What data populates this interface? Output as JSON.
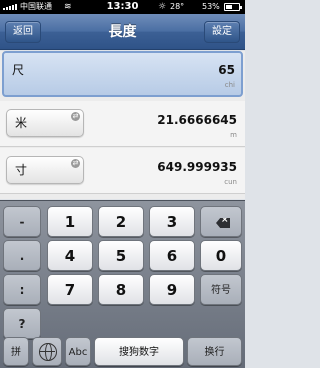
{
  "status_bar": {
    "carrier": "中国联通",
    "wifi_icon": "wifi-icon",
    "time": "13:30",
    "weather_icon": "sun-icon",
    "temperature": "28°",
    "battery_percent": "53%",
    "battery_level": 0.53
  },
  "nav": {
    "back_label": "返回",
    "title": "長度",
    "settings_label": "設定"
  },
  "rows": [
    {
      "unit": "尺",
      "value": "65",
      "sub": "chi",
      "selected": true
    },
    {
      "unit": "米",
      "value": "21.6666645",
      "sub": "m",
      "selected": false
    },
    {
      "unit": "寸",
      "value": "649.999935",
      "sub": "cun",
      "selected": false
    }
  ],
  "keyboard": {
    "left_keys": [
      "-",
      ".",
      ":",
      "?"
    ],
    "row1": [
      "1",
      "2",
      "3"
    ],
    "row2": [
      "4",
      "5",
      "6",
      "0"
    ],
    "row3": [
      "7",
      "8",
      "9"
    ],
    "symbols_label": "符号",
    "delete_icon": "backspace-icon",
    "pinyin_label": "拼",
    "globe_icon": "globe-icon",
    "abc_label": "Abc",
    "search_digits_label": "搜狗数字",
    "return_label": "换行"
  }
}
